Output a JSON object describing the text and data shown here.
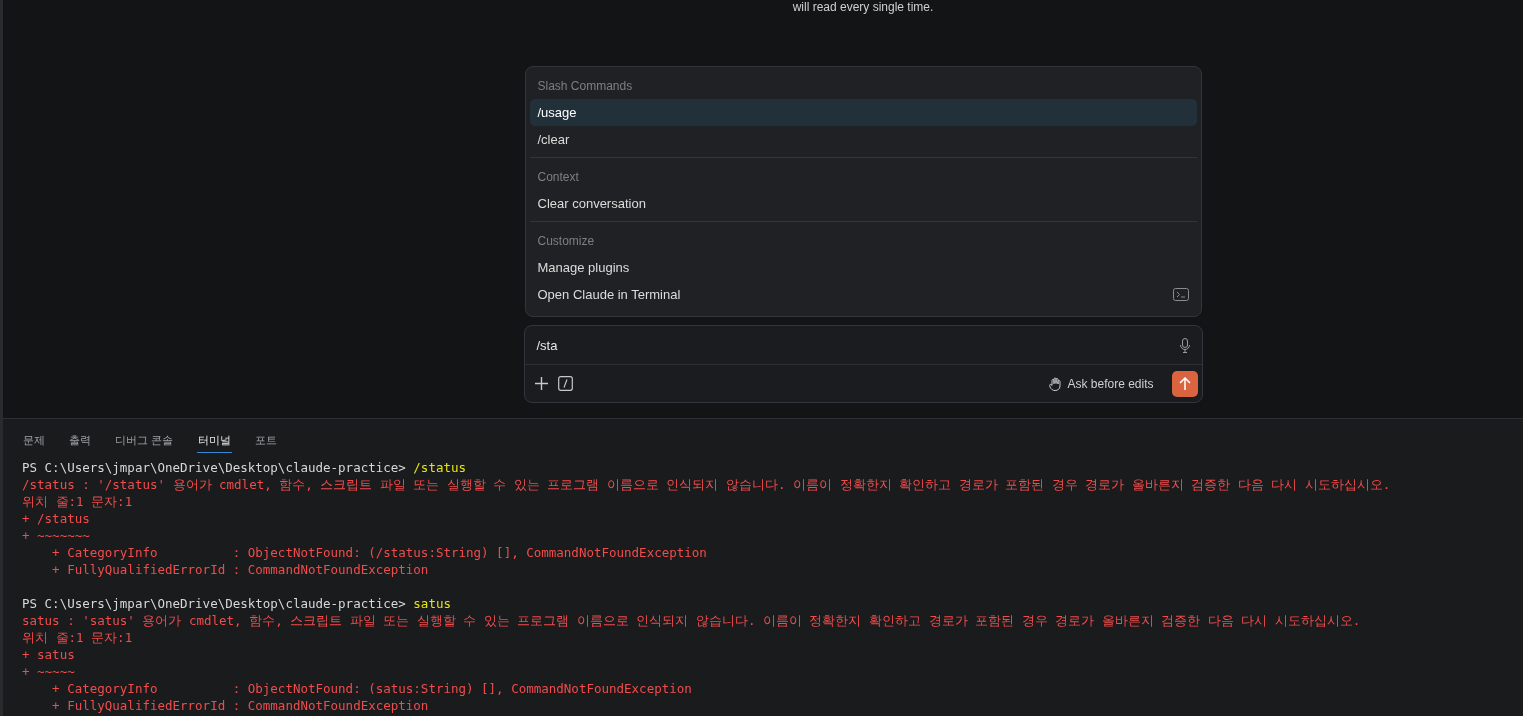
{
  "hint_text": "will read every single time.",
  "command_menu": {
    "sections": [
      {
        "title": "Slash Commands",
        "items": [
          {
            "label": "/usage",
            "selected": true,
            "kind": "plain"
          },
          {
            "label": "/clear",
            "selected": false,
            "kind": "plain"
          }
        ]
      },
      {
        "title": "Context",
        "items": [
          {
            "label": "Clear conversation",
            "selected": false,
            "kind": "plain"
          }
        ]
      },
      {
        "title": "Customize",
        "items": [
          {
            "label": "Manage plugins",
            "selected": false,
            "kind": "plain"
          },
          {
            "label": "Open Claude in Terminal",
            "selected": false,
            "kind": "terminal"
          }
        ]
      }
    ]
  },
  "composer": {
    "value": "/sta",
    "mode_label": "Ask before edits"
  },
  "panel_tabs": [
    {
      "label": "문제",
      "selected": false
    },
    {
      "label": "출력",
      "selected": false
    },
    {
      "label": "디버그 콘솔",
      "selected": false
    },
    {
      "label": "터미널",
      "selected": true
    },
    {
      "label": "포트",
      "selected": false
    }
  ],
  "terminal": {
    "blocks": [
      {
        "prompt": "PS C:\\Users\\jmpar\\OneDrive\\Desktop\\claude-practice> ",
        "command": "/status",
        "lines": [
          "/status : '/status' 용어가 cmdlet, 함수, 스크립트 파일 또는 실행할 수 있는 프로그램 이름으로 인식되지 않습니다. 이름이 정확한지 확인하고 경로가 포함된 경우 경로가 올바른지 검증한 다음 다시 시도하십시오.",
          "위치 줄:1 문자:1",
          "+ /status",
          "+ ~~~~~~~",
          "    + CategoryInfo          : ObjectNotFound: (/status:String) [], CommandNotFoundException",
          "    + FullyQualifiedErrorId : CommandNotFoundException"
        ]
      },
      {
        "prompt": "PS C:\\Users\\jmpar\\OneDrive\\Desktop\\claude-practice> ",
        "command": "satus",
        "lines": [
          "satus : 'satus' 용어가 cmdlet, 함수, 스크립트 파일 또는 실행할 수 있는 프로그램 이름으로 인식되지 않습니다. 이름이 정확한지 확인하고 경로가 포함된 경우 경로가 올바른지 검증한 다음 다시 시도하십시오.",
          "위치 줄:1 문자:1",
          "+ satus",
          "+ ~~~~~",
          "    + CategoryInfo          : ObjectNotFound: (satus:String) [], CommandNotFoundException",
          "    + FullyQualifiedErrorId : CommandNotFoundException"
        ]
      }
    ]
  }
}
